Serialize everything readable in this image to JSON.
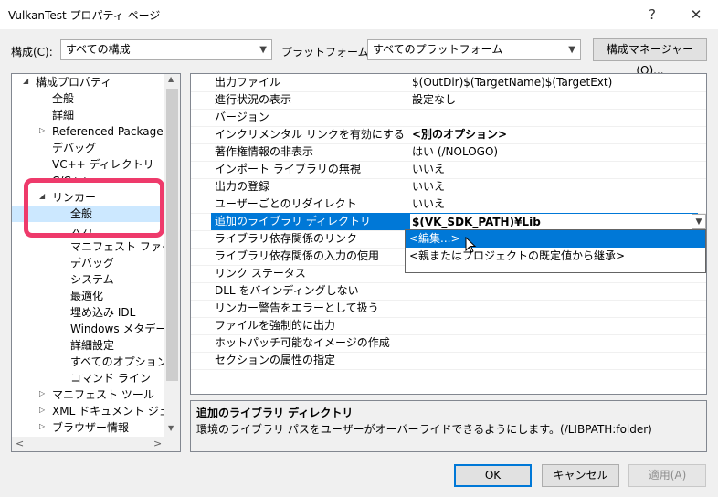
{
  "window": {
    "title": "VulkanTest プロパティ ページ",
    "help": "?",
    "close": "✕"
  },
  "toolbar": {
    "config_label": "構成(C):",
    "config_value": "すべての構成",
    "platform_label": "プラットフォーム(P):",
    "platform_value": "すべてのプラットフォーム",
    "manager_button": "構成マネージャー(O)..."
  },
  "tree": {
    "root": "構成プロパティ",
    "items": [
      {
        "label": "全般"
      },
      {
        "label": "詳細"
      },
      {
        "label": "Referenced Packages"
      },
      {
        "label": "デバッグ"
      },
      {
        "label": "VC++ ディレクトリ"
      },
      {
        "label": "C/C++"
      },
      {
        "label": "リンカー"
      },
      {
        "label": "全般"
      },
      {
        "label": "入力"
      },
      {
        "label": "マニフェスト ファイル"
      },
      {
        "label": "デバッグ"
      },
      {
        "label": "システム"
      },
      {
        "label": "最適化"
      },
      {
        "label": "埋め込み IDL"
      },
      {
        "label": "Windows メタデータ"
      },
      {
        "label": "詳細設定"
      },
      {
        "label": "すべてのオプション"
      },
      {
        "label": "コマンド ライン"
      },
      {
        "label": "マニフェスト ツール"
      },
      {
        "label": "XML ドキュメント ジェネレー"
      },
      {
        "label": "ブラウザー情報"
      }
    ]
  },
  "properties": [
    {
      "name": "出力ファイル",
      "value": "$(OutDir)$(TargetName)$(TargetExt)"
    },
    {
      "name": "進行状況の表示",
      "value": "設定なし"
    },
    {
      "name": "バージョン",
      "value": ""
    },
    {
      "name": "インクリメンタル リンクを有効にする",
      "value": "<別のオプション>"
    },
    {
      "name": "著作権情報の非表示",
      "value": "はい (/NOLOGO)"
    },
    {
      "name": "インポート ライブラリの無視",
      "value": "いいえ"
    },
    {
      "name": "出力の登録",
      "value": "いいえ"
    },
    {
      "name": "ユーザーごとのリダイレクト",
      "value": "いいえ"
    },
    {
      "name": "追加のライブラリ ディレクトリ",
      "value": "$(VK_SDK_PATH)¥Lib"
    },
    {
      "name": "ライブラリ依存関係のリンク",
      "value": ""
    },
    {
      "name": "ライブラリ依存関係の入力の使用",
      "value": ""
    },
    {
      "name": "リンク ステータス",
      "value": ""
    },
    {
      "name": "DLL をバインディングしない",
      "value": ""
    },
    {
      "name": "リンカー警告をエラーとして扱う",
      "value": ""
    },
    {
      "name": "ファイルを強制的に出力",
      "value": ""
    },
    {
      "name": "ホットパッチ可能なイメージの作成",
      "value": ""
    },
    {
      "name": "セクションの属性の指定",
      "value": ""
    }
  ],
  "dropdown": {
    "edit": "<編集...>",
    "inherit": "<親またはプロジェクトの既定値から継承>"
  },
  "description": {
    "title": "追加のライブラリ ディレクトリ",
    "text": "環境のライブラリ パスをユーザーがオーバーライドできるようにします。(/LIBPATH:folder)"
  },
  "buttons": {
    "ok": "OK",
    "cancel": "キャンセル",
    "apply": "適用(A)"
  },
  "colors": {
    "selection": "#0078d7",
    "annotation": "#ee3a6b"
  }
}
